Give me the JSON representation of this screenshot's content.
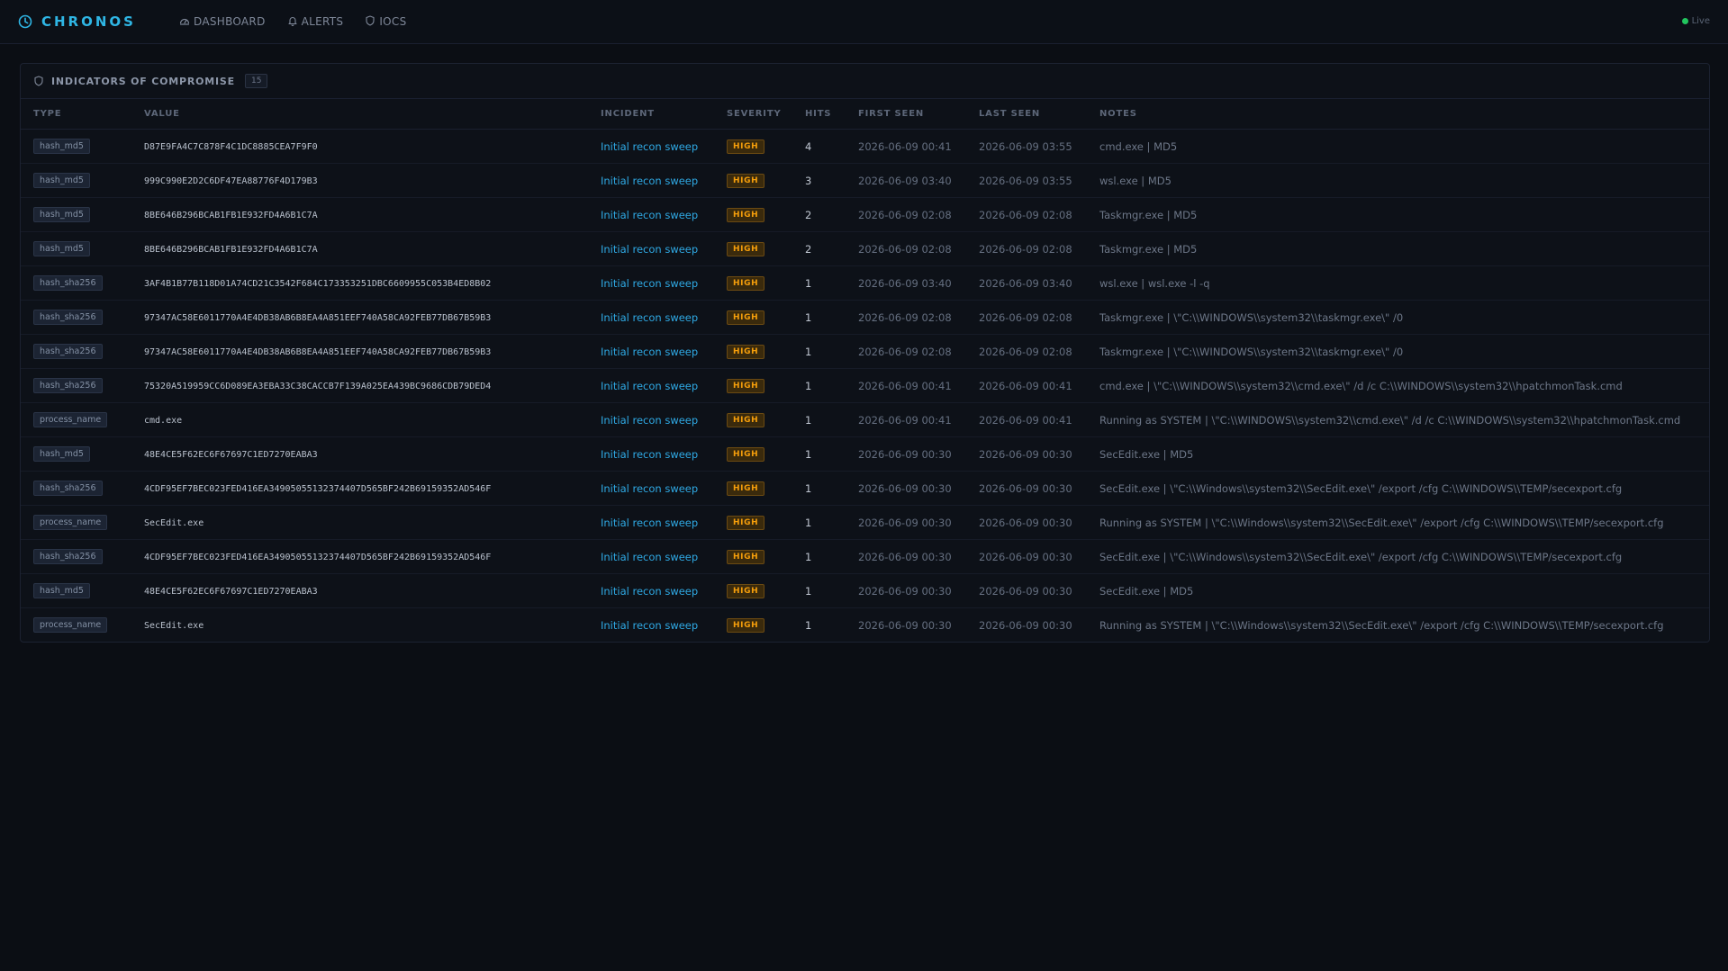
{
  "app": {
    "name": "CHRONOS",
    "brand_color": "#2fb6e5"
  },
  "nav": [
    {
      "label": "DASHBOARD",
      "icon": "dashboard-icon"
    },
    {
      "label": "ALERTS",
      "icon": "bell-icon"
    },
    {
      "label": "IOCS",
      "icon": "shield-icon"
    }
  ],
  "status": {
    "label": "Live",
    "color": "#22c55e"
  },
  "panel": {
    "title": "INDICATORS OF COMPROMISE",
    "count": "15",
    "icon": "shield-icon"
  },
  "table": {
    "columns": [
      "TYPE",
      "VALUE",
      "INCIDENT",
      "SEVERITY",
      "HITS",
      "FIRST SEEN",
      "LAST SEEN",
      "NOTES"
    ],
    "rows": [
      {
        "type": "hash_md5",
        "value": "D87E9FA4C7C878F4C1DC8885CEA7F9F0",
        "incident": "Initial recon sweep",
        "severity": "HIGH",
        "hits": "4",
        "first_seen": "2026-06-09 00:41",
        "last_seen": "2026-06-09 03:55",
        "notes": "cmd.exe | MD5"
      },
      {
        "type": "hash_md5",
        "value": "999C990E2D2C6DF47EA88776F4D179B3",
        "incident": "Initial recon sweep",
        "severity": "HIGH",
        "hits": "3",
        "first_seen": "2026-06-09 03:40",
        "last_seen": "2026-06-09 03:55",
        "notes": "wsl.exe | MD5"
      },
      {
        "type": "hash_md5",
        "value": "8BE646B296BCAB1FB1E932FD4A6B1C7A",
        "incident": "Initial recon sweep",
        "severity": "HIGH",
        "hits": "2",
        "first_seen": "2026-06-09 02:08",
        "last_seen": "2026-06-09 02:08",
        "notes": "Taskmgr.exe | MD5"
      },
      {
        "type": "hash_md5",
        "value": "8BE646B296BCAB1FB1E932FD4A6B1C7A",
        "incident": "Initial recon sweep",
        "severity": "HIGH",
        "hits": "2",
        "first_seen": "2026-06-09 02:08",
        "last_seen": "2026-06-09 02:08",
        "notes": "Taskmgr.exe | MD5"
      },
      {
        "type": "hash_sha256",
        "value": "3AF4B1B77B118D01A74CD21C3542F684C173353251DBC6609955C053B4ED8B02",
        "incident": "Initial recon sweep",
        "severity": "HIGH",
        "hits": "1",
        "first_seen": "2026-06-09 03:40",
        "last_seen": "2026-06-09 03:40",
        "notes": "wsl.exe | wsl.exe -l -q"
      },
      {
        "type": "hash_sha256",
        "value": "97347AC58E6011770A4E4DB38AB6B8EA4A851EEF740A58CA92FEB77DB67B59B3",
        "incident": "Initial recon sweep",
        "severity": "HIGH",
        "hits": "1",
        "first_seen": "2026-06-09 02:08",
        "last_seen": "2026-06-09 02:08",
        "notes": "Taskmgr.exe | \\\"C:\\\\WINDOWS\\\\system32\\\\taskmgr.exe\\\" /0"
      },
      {
        "type": "hash_sha256",
        "value": "97347AC58E6011770A4E4DB38AB6B8EA4A851EEF740A58CA92FEB77DB67B59B3",
        "incident": "Initial recon sweep",
        "severity": "HIGH",
        "hits": "1",
        "first_seen": "2026-06-09 02:08",
        "last_seen": "2026-06-09 02:08",
        "notes": "Taskmgr.exe | \\\"C:\\\\WINDOWS\\\\system32\\\\taskmgr.exe\\\" /0"
      },
      {
        "type": "hash_sha256",
        "value": "75320A519959CC6D089EA3EBA33C38CACCB7F139A025EA439BC9686CDB79DED4",
        "incident": "Initial recon sweep",
        "severity": "HIGH",
        "hits": "1",
        "first_seen": "2026-06-09 00:41",
        "last_seen": "2026-06-09 00:41",
        "notes": "cmd.exe | \\\"C:\\\\WINDOWS\\\\system32\\\\cmd.exe\\\" /d /c C:\\\\WINDOWS\\\\system32\\\\hpatchmonTask.cmd"
      },
      {
        "type": "process_name",
        "value": "cmd.exe",
        "incident": "Initial recon sweep",
        "severity": "HIGH",
        "hits": "1",
        "first_seen": "2026-06-09 00:41",
        "last_seen": "2026-06-09 00:41",
        "notes": "Running as SYSTEM | \\\"C:\\\\WINDOWS\\\\system32\\\\cmd.exe\\\" /d /c C:\\\\WINDOWS\\\\system32\\\\hpatchmonTask.cmd"
      },
      {
        "type": "hash_md5",
        "value": "48E4CE5F62EC6F67697C1ED7270EABA3",
        "incident": "Initial recon sweep",
        "severity": "HIGH",
        "hits": "1",
        "first_seen": "2026-06-09 00:30",
        "last_seen": "2026-06-09 00:30",
        "notes": "SecEdit.exe | MD5"
      },
      {
        "type": "hash_sha256",
        "value": "4CDF95EF7BEC023FED416EA34905055132374407D565BF242B69159352AD546F",
        "incident": "Initial recon sweep",
        "severity": "HIGH",
        "hits": "1",
        "first_seen": "2026-06-09 00:30",
        "last_seen": "2026-06-09 00:30",
        "notes": "SecEdit.exe | \\\"C:\\\\Windows\\\\system32\\\\SecEdit.exe\\\" /export /cfg C:\\\\WINDOWS\\\\TEMP/secexport.cfg"
      },
      {
        "type": "process_name",
        "value": "SecEdit.exe",
        "incident": "Initial recon sweep",
        "severity": "HIGH",
        "hits": "1",
        "first_seen": "2026-06-09 00:30",
        "last_seen": "2026-06-09 00:30",
        "notes": "Running as SYSTEM | \\\"C:\\\\Windows\\\\system32\\\\SecEdit.exe\\\" /export /cfg C:\\\\WINDOWS\\\\TEMP/secexport.cfg"
      },
      {
        "type": "hash_sha256",
        "value": "4CDF95EF7BEC023FED416EA34905055132374407D565BF242B69159352AD546F",
        "incident": "Initial recon sweep",
        "severity": "HIGH",
        "hits": "1",
        "first_seen": "2026-06-09 00:30",
        "last_seen": "2026-06-09 00:30",
        "notes": "SecEdit.exe | \\\"C:\\\\Windows\\\\system32\\\\SecEdit.exe\\\" /export /cfg C:\\\\WINDOWS\\\\TEMP/secexport.cfg"
      },
      {
        "type": "hash_md5",
        "value": "48E4CE5F62EC6F67697C1ED7270EABA3",
        "incident": "Initial recon sweep",
        "severity": "HIGH",
        "hits": "1",
        "first_seen": "2026-06-09 00:30",
        "last_seen": "2026-06-09 00:30",
        "notes": "SecEdit.exe | MD5"
      },
      {
        "type": "process_name",
        "value": "SecEdit.exe",
        "incident": "Initial recon sweep",
        "severity": "HIGH",
        "hits": "1",
        "first_seen": "2026-06-09 00:30",
        "last_seen": "2026-06-09 00:30",
        "notes": "Running as SYSTEM | \\\"C:\\\\Windows\\\\system32\\\\SecEdit.exe\\\" /export /cfg C:\\\\WINDOWS\\\\TEMP/secexport.cfg"
      }
    ]
  }
}
